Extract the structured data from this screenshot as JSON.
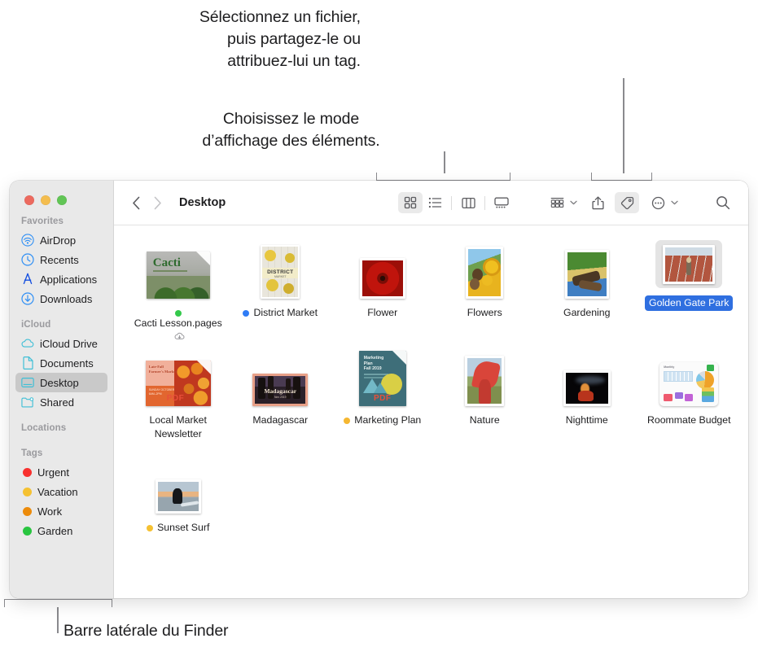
{
  "callouts": {
    "top_right": "Sélectionnez un fichier,\npuis partagez-le ou\nattribuez-lui un tag.",
    "view_mode": "Choisissez le mode\nd’affichage des éléments.",
    "sidebar": "Barre latérale du Finder"
  },
  "window": {
    "traffic_lights": [
      "close",
      "minimize",
      "zoom"
    ]
  },
  "toolbar": {
    "back_label": "‹",
    "forward_label": "›",
    "path_title": "Desktop",
    "view_buttons": [
      {
        "name": "icon-view",
        "label": "Présentation par icônes",
        "active": true
      },
      {
        "name": "list-view",
        "label": "Présentation par liste",
        "active": false
      },
      {
        "name": "column-view",
        "label": "Présentation par colonnes",
        "active": false
      },
      {
        "name": "gallery-view",
        "label": "Présentation par galerie",
        "active": false
      }
    ],
    "group_button": {
      "label": "Grouper",
      "has_chevron": true
    },
    "share_button": {
      "label": "Partager"
    },
    "tag_button": {
      "label": "Tags",
      "active": true
    },
    "more_button": {
      "label": "Plus",
      "has_chevron": true
    },
    "search_button": {
      "label": "Rechercher"
    }
  },
  "sidebar": {
    "groups": [
      {
        "header": "Favorites",
        "items": [
          {
            "label": "AirDrop",
            "icon": "airdrop-icon",
            "selected": false
          },
          {
            "label": "Recents",
            "icon": "clock-icon",
            "selected": false
          },
          {
            "label": "Applications",
            "icon": "applications-icon",
            "selected": false
          },
          {
            "label": "Downloads",
            "icon": "download-icon",
            "selected": false
          }
        ]
      },
      {
        "header": "iCloud",
        "items": [
          {
            "label": "iCloud Drive",
            "icon": "cloud-icon",
            "selected": false
          },
          {
            "label": "Documents",
            "icon": "document-icon",
            "selected": false
          },
          {
            "label": "Desktop",
            "icon": "desktop-icon",
            "selected": true
          },
          {
            "label": "Shared",
            "icon": "shared-folder-icon",
            "selected": false
          }
        ]
      },
      {
        "header": "Locations",
        "items": []
      },
      {
        "header": "Tags",
        "items": [
          {
            "label": "Urgent",
            "icon": "tag-dot",
            "color": "#f8312f",
            "selected": false
          },
          {
            "label": "Vacation",
            "icon": "tag-dot",
            "color": "#f5c132",
            "selected": false
          },
          {
            "label": "Work",
            "icon": "tag-dot",
            "color": "#ec8b0b",
            "selected": false
          },
          {
            "label": "Garden",
            "icon": "tag-dot",
            "color": "#29c540",
            "selected": false
          }
        ]
      }
    ]
  },
  "files": [
    {
      "name": "Cacti Lesson.pages",
      "kind": "pages-document",
      "tag_color": "#34c94b",
      "selected": false,
      "cloud_badge": true
    },
    {
      "name": "District Market",
      "kind": "photo-portrait",
      "tag_color": "#2f7cf6",
      "selected": false,
      "cloud_badge": false
    },
    {
      "name": "Flower",
      "kind": "photo-landscape",
      "tag_color": null,
      "selected": false,
      "cloud_badge": false
    },
    {
      "name": "Flowers",
      "kind": "photo-portrait",
      "tag_color": null,
      "selected": false,
      "cloud_badge": false
    },
    {
      "name": "Gardening",
      "kind": "photo-portrait",
      "tag_color": null,
      "selected": false,
      "cloud_badge": false
    },
    {
      "name": "Golden Gate Park",
      "kind": "photo-landscape",
      "tag_color": null,
      "selected": true,
      "cloud_badge": false
    },
    {
      "name": "Local Market Newsletter",
      "kind": "pdf-document",
      "tag_color": null,
      "selected": false,
      "cloud_badge": false
    },
    {
      "name": "Madagascar",
      "kind": "photo-landscape",
      "tag_color": null,
      "selected": false,
      "cloud_badge": false
    },
    {
      "name": "Marketing Plan",
      "kind": "pdf-document",
      "tag_color": "#f5b731",
      "selected": false,
      "cloud_badge": false
    },
    {
      "name": "Nature",
      "kind": "photo-portrait",
      "tag_color": null,
      "selected": false,
      "cloud_badge": false
    },
    {
      "name": "Nighttime",
      "kind": "photo-landscape",
      "tag_color": null,
      "selected": false,
      "cloud_badge": false
    },
    {
      "name": "Roommate Budget",
      "kind": "numbers-document",
      "tag_color": null,
      "selected": false,
      "cloud_badge": false
    },
    {
      "name": "Sunset Surf",
      "kind": "photo-landscape",
      "tag_color": "#f5c132",
      "selected": false,
      "cloud_badge": false
    }
  ],
  "colors": {
    "selection_blue": "#2f6fe0",
    "sidebar_bg": "#e9e9e9",
    "sidebar_selected": "#c9c9c9",
    "toolbar_active": "#eaeaea",
    "callout_line": "#8a8a8e"
  }
}
